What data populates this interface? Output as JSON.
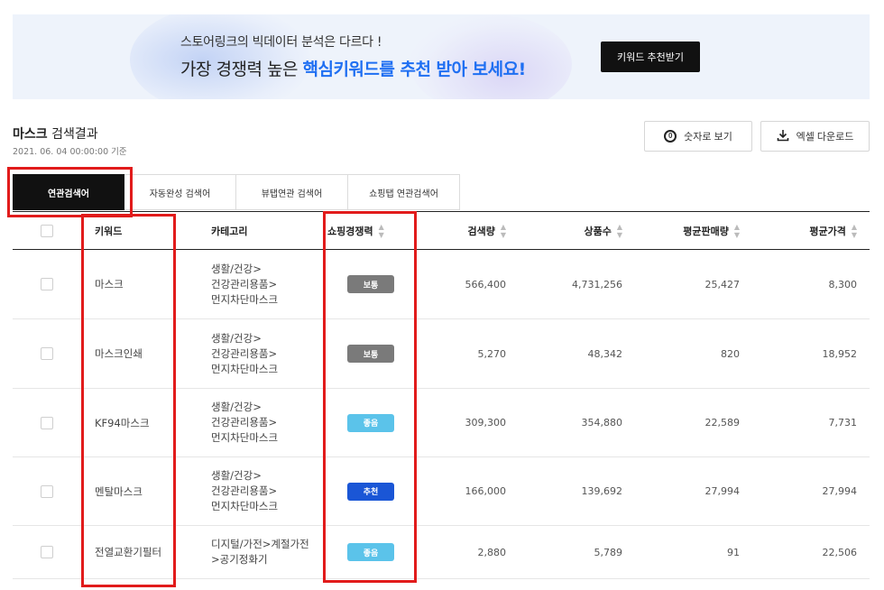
{
  "banner": {
    "line1": "스토어링크의 빅데이터 분석은 다르다 !",
    "line2_prefix": "가장 경쟁력 높은 ",
    "line2_highlight": "핵심키워드를 추천 받아 보세요!",
    "button_label": "키워드 추천받기"
  },
  "result": {
    "keyword": "마스크",
    "title_suffix": " 검색결과",
    "date": "2021. 06. 04 00:00:00 기준"
  },
  "actions": {
    "number_view_label": "숫자로 보기",
    "number_view_icon": "0",
    "excel_download_label": "엑셀 다운로드"
  },
  "tabs": [
    {
      "label": "연관검색어",
      "active": true
    },
    {
      "label": "자동완성 검색어",
      "active": false
    },
    {
      "label": "뷰탭연관 검색어",
      "active": false
    },
    {
      "label": "쇼핑탭 연관검색어",
      "active": false
    }
  ],
  "table": {
    "headers": {
      "keyword": "키워드",
      "category": "카테고리",
      "competition": "쇼핑경쟁력",
      "search_volume": "검색량",
      "product_count": "상품수",
      "avg_sales": "평균판매량",
      "avg_price": "평균가격"
    },
    "rows": [
      {
        "keyword": "마스크",
        "category": "생활/건강>건강관리용품>먼지차단마스크",
        "competition": "보통",
        "search_volume": "566,400",
        "product_count": "4,731,256",
        "avg_sales": "25,427",
        "avg_price": "8,300"
      },
      {
        "keyword": "마스크인쇄",
        "category": "생활/건강>건강관리용품>먼지차단마스크",
        "competition": "보통",
        "search_volume": "5,270",
        "product_count": "48,342",
        "avg_sales": "820",
        "avg_price": "18,952"
      },
      {
        "keyword": "KF94마스크",
        "category": "생활/건강>건강관리용품>먼지차단마스크",
        "competition": "좋음",
        "search_volume": "309,300",
        "product_count": "354,880",
        "avg_sales": "22,589",
        "avg_price": "7,731"
      },
      {
        "keyword": "멘탈마스크",
        "category": "생활/건강>건강관리용품>먼지차단마스크",
        "competition": "추천",
        "search_volume": "166,000",
        "product_count": "139,692",
        "avg_sales": "27,994",
        "avg_price": "27,994"
      },
      {
        "keyword": "전열교환기필터",
        "category": "디지털/가전>계절가전>공기정화기",
        "competition": "좋음",
        "search_volume": "2,880",
        "product_count": "5,789",
        "avg_sales": "91",
        "avg_price": "22,506"
      }
    ]
  },
  "badge_colors": {
    "보통": "#7a7a7a",
    "좋음": "#5bc3ea",
    "추천": "#1a56d6"
  },
  "annotation_color": "#e11b1b"
}
